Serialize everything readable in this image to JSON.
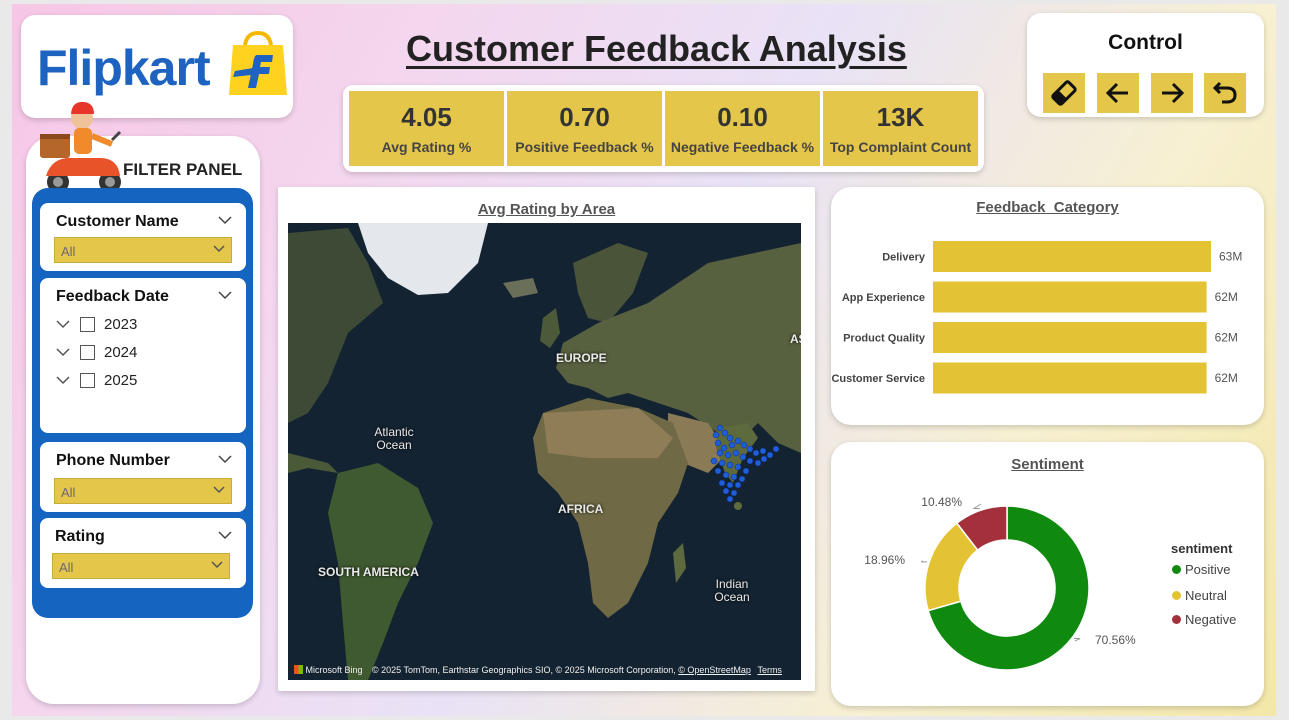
{
  "header": {
    "brand": "Flipkart",
    "title": "Customer Feedback Analysis"
  },
  "kpis": [
    {
      "value": "4.05",
      "label": "Avg Rating %"
    },
    {
      "value": "0.70",
      "label": "Positive Feedback %"
    },
    {
      "value": "0.10",
      "label": "Negative Feedback %"
    },
    {
      "value": "13K",
      "label": "Top Complaint Count"
    }
  ],
  "control": {
    "title": "Control",
    "buttons": [
      "eraser-icon",
      "arrow-left-icon",
      "arrow-right-icon",
      "undo-icon"
    ]
  },
  "filters": {
    "title": "FILTER PANEL",
    "customer_name": {
      "label": "Customer Name",
      "value": "All"
    },
    "feedback_date": {
      "label": "Feedback Date",
      "years": [
        "2023",
        "2024",
        "2025"
      ]
    },
    "phone_number": {
      "label": "Phone Number",
      "value": "All"
    },
    "rating": {
      "label": "Rating",
      "value": "All"
    }
  },
  "map": {
    "title": "Avg Rating by Area",
    "labels": {
      "europe": "EUROPE",
      "atlantic": "Atlantic\nOcean",
      "africa": "AFRICA",
      "south_america": "SOUTH AMERICA",
      "indian": "Indian\nOcean",
      "asia_cut": "AS"
    },
    "footer_brand": "Microsoft Bing",
    "footer_credit": "© 2025 TomTom, Earthstar Geographics SIO, © 2025 Microsoft Corporation,",
    "footer_osm": "© OpenStreetMap",
    "footer_terms": "Terms"
  },
  "chart_data": [
    {
      "type": "bar",
      "orientation": "horizontal",
      "title": "Feedback_Category",
      "categories": [
        "Delivery",
        "App Experience",
        "Product Quality",
        "Customer Service"
      ],
      "values": [
        63,
        62,
        62,
        62
      ],
      "value_labels": [
        "63M",
        "62M",
        "62M",
        "62M"
      ],
      "color": "#e3c233"
    },
    {
      "type": "pie",
      "variant": "donut",
      "title": "Sentiment",
      "legend_title": "sentiment",
      "legend_position": "right",
      "slices": [
        {
          "name": "Positive",
          "value": 70.56,
          "label": "70.56%",
          "color": "#0f8a0f"
        },
        {
          "name": "Neutral",
          "value": 18.96,
          "label": "18.96%",
          "color": "#e3c233"
        },
        {
          "name": "Negative",
          "value": 10.48,
          "label": "10.48%",
          "color": "#a3303a"
        }
      ]
    }
  ]
}
